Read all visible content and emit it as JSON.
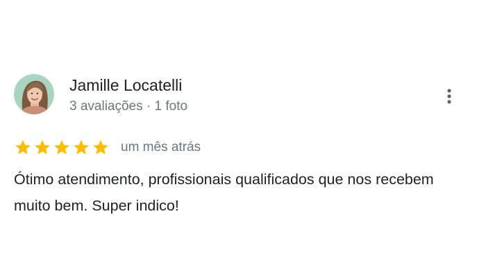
{
  "review": {
    "author": {
      "name": "Jamille Locatelli",
      "reviews_count": "3 avaliações",
      "separator": "·",
      "photos_count": "1 foto",
      "avatar_icon": "profile-photo"
    },
    "menu_icon": "more-vert-icon",
    "rating": 5,
    "rating_max": 5,
    "date": "um mês atrás",
    "text": "Ótimo atendimento, profissionais qualificados que nos recebem muito bem. Super indico!"
  },
  "colors": {
    "star": "#fbbc04",
    "primary_text": "#202124",
    "secondary_text": "#70757a",
    "menu_icon": "#5f6368"
  }
}
